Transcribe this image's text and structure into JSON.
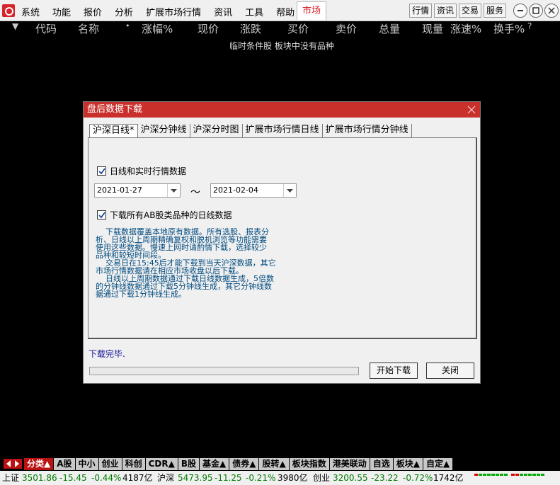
{
  "menubar": {
    "items": [
      "系统",
      "功能",
      "报价",
      "分析",
      "扩展市场行情",
      "资讯",
      "工具",
      "帮助"
    ],
    "market_tab": "市场",
    "quick_buttons": [
      "行情",
      "资讯",
      "交易",
      "服务"
    ]
  },
  "quote_header": {
    "columns": [
      "代码",
      "名称",
      "涨幅%",
      "现价",
      "涨跌",
      "买价",
      "卖价",
      "总量",
      "现量",
      "涨速%",
      "换手%",
      "?"
    ],
    "empty_message": "临时条件股 板块中没有品种"
  },
  "dialog": {
    "title": "盘后数据下载",
    "tabs": [
      "沪深日线*",
      "沪深分钟线",
      "沪深分时图",
      "扩展市场行情日线",
      "扩展市场行情分钟线"
    ],
    "check_daily": "日线和实时行情数据",
    "date_from": "2021-01-27",
    "date_sep": "～",
    "date_to": "2021-02-04",
    "check_all": "下载所有AB股类品种的日线数据",
    "info_lines": [
      "    下载数据覆盖本地原有数据。所有选股、报表分",
      "析、日线以上周期精确复权和脱机浏览等功能需要",
      "使用这些数据。慢速上网时请酌情下载，选择较少",
      "品种和较短时间段。",
      "    交易日在15:45后才能下载到当天沪深数据，其它",
      "市场行情数据请在相应市场收盘以后下载。",
      "    日线以上周期数据通过下载日线数据生成，5倍数",
      "的分钟线数据通过下载5分钟线生成，其它分钟线数",
      "据通过下载1分钟线生成。"
    ],
    "status": "下载完毕.",
    "progress": 0,
    "start_button": "开始下载",
    "close_button": "关闭"
  },
  "category_tabs": [
    "分类▲",
    "A股",
    "中小",
    "创业",
    "科创",
    "CDR▲",
    "B股",
    "基金▲",
    "债券▲",
    "股转▲",
    "板块指数",
    "港美联动",
    "自选",
    "板块▲",
    "自定▲"
  ],
  "ticker": {
    "sh_name": "上证",
    "sh_value": "3501.86",
    "sh_change": "-15.45",
    "sh_pct": "-0.44%",
    "sh_amount": "4187亿",
    "sz_name": "沪深",
    "sz_value": "5473.95",
    "sz_change": "-11.25",
    "sz_pct": "-0.21%",
    "sz_amount": "3980亿",
    "cy_name": "创业",
    "cy_value": "3200.55",
    "cy_change": "-23.22",
    "cy_pct": "-0.72%",
    "cy_amount": "1742亿"
  },
  "colors": {
    "accent_red": "#c9302c",
    "down_green": "#007a00",
    "market_red": "#d8232a"
  }
}
